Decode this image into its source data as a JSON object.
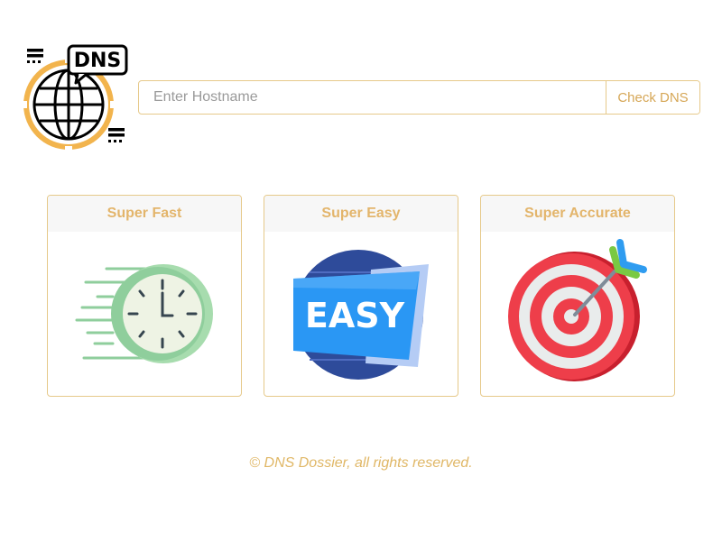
{
  "logo": {
    "label": "DNS"
  },
  "search": {
    "placeholder": "Enter Hostname",
    "button_label": "Check DNS"
  },
  "features": [
    {
      "title": "Super Fast",
      "icon": "stopwatch-icon"
    },
    {
      "title": "Super Easy",
      "icon": "easy-badge-icon",
      "badge_text": "EASY"
    },
    {
      "title": "Super Accurate",
      "icon": "target-icon"
    }
  ],
  "footer": {
    "text": "© DNS Dossier, all rights reserved."
  },
  "colors": {
    "accent": "#e0b766",
    "border": "#e6c98a",
    "header_bg": "#f7f7f7"
  }
}
